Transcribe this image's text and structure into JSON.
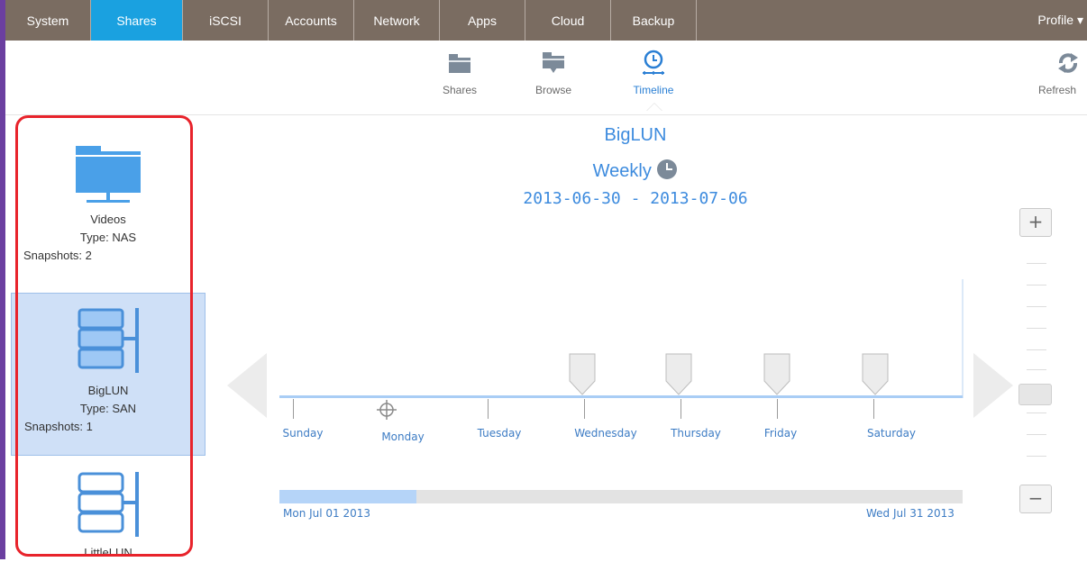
{
  "nav": {
    "tabs": [
      {
        "label": "System"
      },
      {
        "label": "Shares",
        "active": true
      },
      {
        "label": "iSCSI"
      },
      {
        "label": "Accounts"
      },
      {
        "label": "Network"
      },
      {
        "label": "Apps"
      },
      {
        "label": "Cloud"
      },
      {
        "label": "Backup"
      }
    ],
    "profile_label": "Profile ▾"
  },
  "toolbar": {
    "shares_label": "Shares",
    "browse_label": "Browse",
    "timeline_label": "Timeline",
    "refresh_label": "Refresh"
  },
  "sidebar": {
    "shares": [
      {
        "name": "Videos",
        "type": "Type: NAS",
        "snapshots": "Snapshots: 2",
        "icon": "folder-network-icon"
      },
      {
        "name": "BigLUN",
        "type": "Type: SAN",
        "snapshots": "Snapshots: 1",
        "icon": "lun-icon",
        "selected": true
      },
      {
        "name": "LittleLUN",
        "icon": "lun-outline-icon"
      }
    ]
  },
  "main": {
    "share_title": "BigLUN",
    "schedule": "Weekly",
    "date_range": "2013-06-30 - 2013-07-06",
    "days": [
      "Sunday",
      "Monday",
      "Tuesday",
      "Wednesday",
      "Thursday",
      "Friday",
      "Saturday"
    ],
    "range_start": "Mon Jul 01 2013",
    "range_end": "Wed Jul 31 2013",
    "scroll_position_fraction": 0.2
  },
  "colors": {
    "nav_bg": "#7a6c61",
    "nav_active": "#1aa1e0",
    "accent": "#3d8bde",
    "highlight_border": "#e8232b",
    "selected_bg": "#cfe0f7"
  }
}
